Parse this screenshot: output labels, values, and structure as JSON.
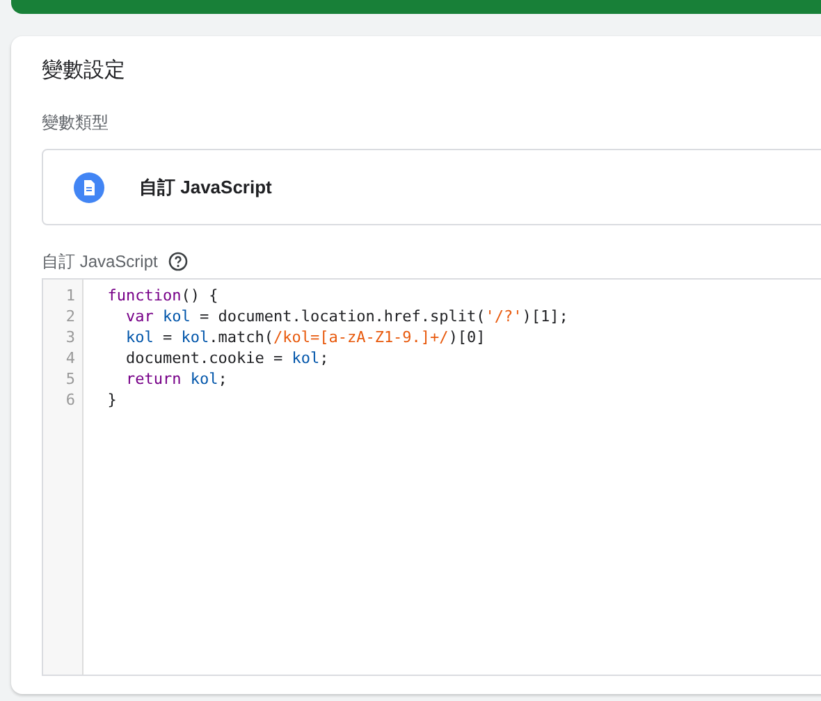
{
  "title": "變數設定",
  "type_section": {
    "label": "變數類型",
    "value": "自訂 JavaScript"
  },
  "editor": {
    "label": "自訂 JavaScript",
    "lines": [
      {
        "number": "1",
        "tokens": [
          {
            "kind": "keyword",
            "text": "  function"
          },
          {
            "kind": "plain",
            "text": "() {"
          }
        ]
      },
      {
        "number": "2",
        "tokens": [
          {
            "kind": "keyword",
            "text": "    var"
          },
          {
            "kind": "variable",
            "text": " kol"
          },
          {
            "kind": "plain",
            "text": " = document.location.href.split("
          },
          {
            "kind": "string",
            "text": "'/?'"
          },
          {
            "kind": "plain",
            "text": ")[1];"
          }
        ]
      },
      {
        "number": "3",
        "tokens": [
          {
            "kind": "variable",
            "text": "    kol"
          },
          {
            "kind": "plain",
            "text": " = "
          },
          {
            "kind": "variable",
            "text": "kol"
          },
          {
            "kind": "plain",
            "text": ".match("
          },
          {
            "kind": "string",
            "text": "/kol=[a-zA-Z1-9.]+/"
          },
          {
            "kind": "plain",
            "text": ")[0]"
          }
        ]
      },
      {
        "number": "4",
        "tokens": [
          {
            "kind": "plain",
            "text": "    document.cookie = "
          },
          {
            "kind": "variable",
            "text": "kol"
          },
          {
            "kind": "plain",
            "text": ";"
          }
        ]
      },
      {
        "number": "5",
        "tokens": [
          {
            "kind": "keyword",
            "text": "    return"
          },
          {
            "kind": "variable",
            "text": " kol"
          },
          {
            "kind": "plain",
            "text": ";"
          }
        ]
      },
      {
        "number": "6",
        "tokens": [
          {
            "kind": "plain",
            "text": "  }"
          }
        ]
      }
    ]
  }
}
